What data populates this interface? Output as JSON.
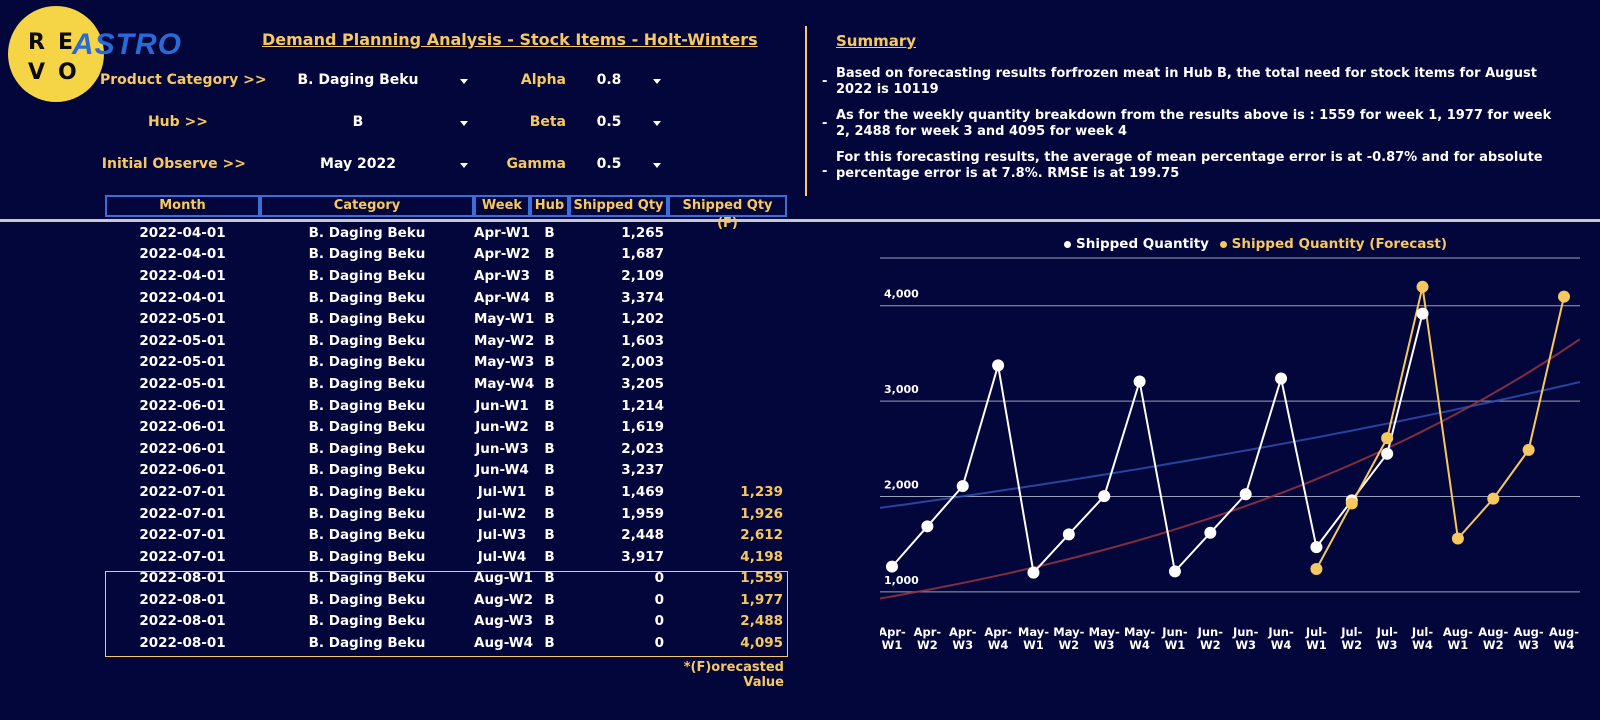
{
  "logo": {
    "letters": [
      "R",
      "E",
      "V",
      "O"
    ],
    "brand": "ASTRO"
  },
  "title": "Demand Planning Analysis - Stock Items - Holt-Winters",
  "filters": {
    "product_category": {
      "label": "Product Category >>",
      "value": "B. Daging Beku"
    },
    "hub": {
      "label": "Hub >>",
      "value": "B"
    },
    "initial_observe": {
      "label": "Initial Observe >>",
      "value": "May 2022"
    },
    "alpha": {
      "label": "Alpha",
      "value": "0.8"
    },
    "beta": {
      "label": "Beta",
      "value": "0.5"
    },
    "gamma": {
      "label": "Gamma",
      "value": "0.5"
    }
  },
  "summary": {
    "title": "Summary",
    "items": [
      "Based on forecasting results forfrozen meat in Hub B, the total need for stock items for August 2022 is 10119",
      "As for the weekly quantity breakdown from the results above is : 1559 for week 1, 1977 for week 2, 2488 for week 3 and 4095 for week 4",
      "For this forecasting results, the average of mean percentage error is at -0.87% and for absolute percentage error is at 7.8%. RMSE is at 199.75"
    ]
  },
  "table": {
    "headers": [
      "Month",
      "Category",
      "Week",
      "Hub",
      "Shipped Qty",
      "Shipped Qty (F)"
    ],
    "rows": [
      [
        "2022-04-01",
        "B. Daging Beku",
        "Apr-W1",
        "B",
        "1,265",
        ""
      ],
      [
        "2022-04-01",
        "B. Daging Beku",
        "Apr-W2",
        "B",
        "1,687",
        ""
      ],
      [
        "2022-04-01",
        "B. Daging Beku",
        "Apr-W3",
        "B",
        "2,109",
        ""
      ],
      [
        "2022-04-01",
        "B. Daging Beku",
        "Apr-W4",
        "B",
        "3,374",
        ""
      ],
      [
        "2022-05-01",
        "B. Daging Beku",
        "May-W1",
        "B",
        "1,202",
        ""
      ],
      [
        "2022-05-01",
        "B. Daging Beku",
        "May-W2",
        "B",
        "1,603",
        ""
      ],
      [
        "2022-05-01",
        "B. Daging Beku",
        "May-W3",
        "B",
        "2,003",
        ""
      ],
      [
        "2022-05-01",
        "B. Daging Beku",
        "May-W4",
        "B",
        "3,205",
        ""
      ],
      [
        "2022-06-01",
        "B. Daging Beku",
        "Jun-W1",
        "B",
        "1,214",
        ""
      ],
      [
        "2022-06-01",
        "B. Daging Beku",
        "Jun-W2",
        "B",
        "1,619",
        ""
      ],
      [
        "2022-06-01",
        "B. Daging Beku",
        "Jun-W3",
        "B",
        "2,023",
        ""
      ],
      [
        "2022-06-01",
        "B. Daging Beku",
        "Jun-W4",
        "B",
        "3,237",
        ""
      ],
      [
        "2022-07-01",
        "B. Daging Beku",
        "Jul-W1",
        "B",
        "1,469",
        "1,239"
      ],
      [
        "2022-07-01",
        "B. Daging Beku",
        "Jul-W2",
        "B",
        "1,959",
        "1,926"
      ],
      [
        "2022-07-01",
        "B. Daging Beku",
        "Jul-W3",
        "B",
        "2,448",
        "2,612"
      ],
      [
        "2022-07-01",
        "B. Daging Beku",
        "Jul-W4",
        "B",
        "3,917",
        "4,198"
      ],
      [
        "2022-08-01",
        "B. Daging Beku",
        "Aug-W1",
        "B",
        "0",
        "1,559"
      ],
      [
        "2022-08-01",
        "B. Daging Beku",
        "Aug-W2",
        "B",
        "0",
        "1,977"
      ],
      [
        "2022-08-01",
        "B. Daging Beku",
        "Aug-W3",
        "B",
        "0",
        "2,488"
      ],
      [
        "2022-08-01",
        "B. Daging Beku",
        "Aug-W4",
        "B",
        "0",
        "4,095"
      ]
    ],
    "footnote": "*(F)orecasted Value"
  },
  "colors": {
    "background": "#03063a",
    "gold": "#f8c860",
    "white": "#ffffff",
    "table_border": "#3a6fd8",
    "trend_blue": "#2f4fb0",
    "trend_red": "#9a3440"
  },
  "chart_data": {
    "type": "line",
    "legend": [
      "Shipped Quantity",
      "Shipped Quantity (Forecast)"
    ],
    "categories": [
      "Apr-W1",
      "Apr-W2",
      "Apr-W3",
      "Apr-W4",
      "May-W1",
      "May-W2",
      "May-W3",
      "May-W4",
      "Jun-W1",
      "Jun-W2",
      "Jun-W3",
      "Jun-W4",
      "Jul-W1",
      "Jul-W2",
      "Jul-W3",
      "Jul-W4",
      "Aug-W1",
      "Aug-W2",
      "Aug-W3",
      "Aug-W4"
    ],
    "series": [
      {
        "name": "Shipped Quantity",
        "color": "#ffffff",
        "values": [
          1265,
          1687,
          2109,
          3374,
          1202,
          1603,
          2003,
          3205,
          1214,
          1619,
          2023,
          3237,
          1469,
          1959,
          2448,
          3917,
          null,
          null,
          null,
          null
        ]
      },
      {
        "name": "Shipped Quantity (Forecast)",
        "color": "#f8c860",
        "values": [
          null,
          null,
          null,
          null,
          null,
          null,
          null,
          null,
          null,
          null,
          null,
          null,
          1239,
          1926,
          2612,
          4198,
          1559,
          1977,
          2488,
          4095
        ]
      }
    ],
    "trendlines": [
      {
        "color": "#2f4fb0",
        "start": 1880,
        "end": 3200
      },
      {
        "color": "#9a3440",
        "start": 930,
        "end": 3650
      }
    ],
    "yticks": [
      1000,
      2000,
      3000,
      4000
    ],
    "ytick_labels": [
      "1,000",
      "2,000",
      "3,000",
      "4,000"
    ],
    "ylim": [
      600,
      4500
    ],
    "grid": true,
    "legend_position": "top-center"
  }
}
